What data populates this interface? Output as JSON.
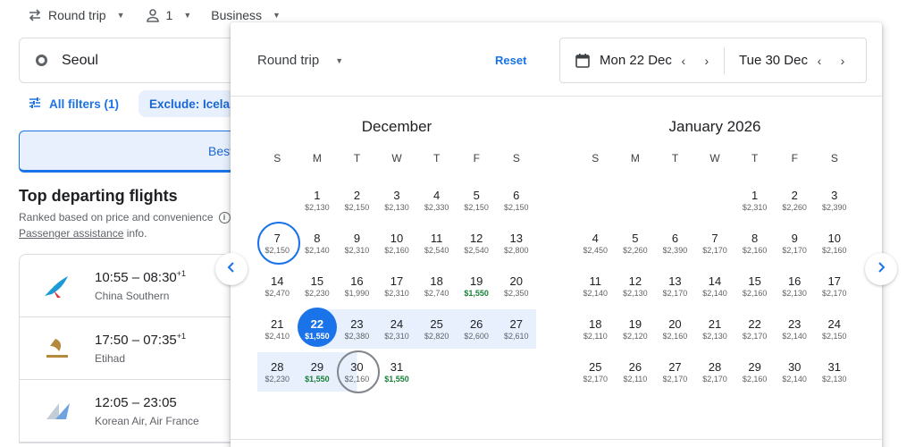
{
  "topbar": {
    "trip_type": "Round trip",
    "passengers": "1",
    "cabin": "Business"
  },
  "origin": {
    "value": "Seoul"
  },
  "filters": {
    "all_filters": "All filters (1)",
    "exclude_chip": "Exclude: Iceland"
  },
  "tabs": {
    "best": "Best"
  },
  "section": {
    "title": "Top departing flights",
    "subtitle": "Ranked based on price and convenience",
    "assistance_link": "Passenger assistance",
    "assistance_suffix": " info."
  },
  "flights": [
    {
      "times": "10:55 – 08:30",
      "plus": "+1",
      "airline": "China Southern"
    },
    {
      "times": "17:50 – 07:35",
      "plus": "+1",
      "airline": "Etihad"
    },
    {
      "times": "12:05 – 23:05",
      "plus": "",
      "airline": "Korean Air, Air France"
    }
  ],
  "popup": {
    "trip_type": "Round trip",
    "reset": "Reset",
    "departure": "Mon 22 Dec",
    "return": "Tue 30 Dec"
  },
  "calendar": {
    "weekdays": [
      "S",
      "M",
      "T",
      "W",
      "T",
      "F",
      "S"
    ],
    "months": [
      {
        "title": "December",
        "offset": 1,
        "days": [
          {
            "d": "1",
            "p": "$2,130"
          },
          {
            "d": "2",
            "p": "$2,150"
          },
          {
            "d": "3",
            "p": "$2,130"
          },
          {
            "d": "4",
            "p": "$2,330"
          },
          {
            "d": "5",
            "p": "$2,150"
          },
          {
            "d": "6",
            "p": "$2,150"
          },
          {
            "d": "7",
            "p": "$2,150"
          },
          {
            "d": "8",
            "p": "$2,140"
          },
          {
            "d": "9",
            "p": "$2,310"
          },
          {
            "d": "10",
            "p": "$2,160"
          },
          {
            "d": "11",
            "p": "$2,540"
          },
          {
            "d": "12",
            "p": "$2,540"
          },
          {
            "d": "13",
            "p": "$2,800"
          },
          {
            "d": "14",
            "p": "$2,470"
          },
          {
            "d": "15",
            "p": "$2,230"
          },
          {
            "d": "16",
            "p": "$1,990"
          },
          {
            "d": "17",
            "p": "$2,310"
          },
          {
            "d": "18",
            "p": "$2,740"
          },
          {
            "d": "19",
            "p": "$1,550",
            "low": true
          },
          {
            "d": "20",
            "p": "$2,350"
          },
          {
            "d": "21",
            "p": "$2,410"
          },
          {
            "d": "22",
            "p": "$1,550",
            "low": true
          },
          {
            "d": "23",
            "p": "$2,380"
          },
          {
            "d": "24",
            "p": "$2,310"
          },
          {
            "d": "25",
            "p": "$2,820"
          },
          {
            "d": "26",
            "p": "$2,600"
          },
          {
            "d": "27",
            "p": "$2,610"
          },
          {
            "d": "28",
            "p": "$2,230"
          },
          {
            "d": "29",
            "p": "$1,550",
            "low": true
          },
          {
            "d": "30",
            "p": "$2,160"
          },
          {
            "d": "31",
            "p": "$1,550",
            "low": true
          }
        ]
      },
      {
        "title": "January 2026",
        "offset": 4,
        "days": [
          {
            "d": "1",
            "p": "$2,310"
          },
          {
            "d": "2",
            "p": "$2,260"
          },
          {
            "d": "3",
            "p": "$2,390"
          },
          {
            "d": "4",
            "p": "$2,450"
          },
          {
            "d": "5",
            "p": "$2,260"
          },
          {
            "d": "6",
            "p": "$2,390"
          },
          {
            "d": "7",
            "p": "$2,170"
          },
          {
            "d": "8",
            "p": "$2,160"
          },
          {
            "d": "9",
            "p": "$2,170"
          },
          {
            "d": "10",
            "p": "$2,160"
          },
          {
            "d": "11",
            "p": "$2,140"
          },
          {
            "d": "12",
            "p": "$2,130"
          },
          {
            "d": "13",
            "p": "$2,170"
          },
          {
            "d": "14",
            "p": "$2,140"
          },
          {
            "d": "15",
            "p": "$2,160"
          },
          {
            "d": "16",
            "p": "$2,130"
          },
          {
            "d": "17",
            "p": "$2,170"
          },
          {
            "d": "18",
            "p": "$2,110"
          },
          {
            "d": "19",
            "p": "$2,120"
          },
          {
            "d": "20",
            "p": "$2,160"
          },
          {
            "d": "21",
            "p": "$2,130"
          },
          {
            "d": "22",
            "p": "$2,170"
          },
          {
            "d": "23",
            "p": "$2,140"
          },
          {
            "d": "24",
            "p": "$2,150"
          },
          {
            "d": "25",
            "p": "$2,170"
          },
          {
            "d": "26",
            "p": "$2,110"
          },
          {
            "d": "27",
            "p": "$2,170"
          },
          {
            "d": "28",
            "p": "$2,170"
          },
          {
            "d": "29",
            "p": "$2,160"
          },
          {
            "d": "30",
            "p": "$2,140"
          },
          {
            "d": "31",
            "p": "$2,130"
          }
        ]
      }
    ],
    "today_ring": "7",
    "selected_departure": "22",
    "selected_return": "30"
  },
  "colors": {
    "accent": "#1a73e8",
    "range": "#e8f0fe",
    "low_price": "#188038"
  },
  "icons": {
    "swap": "swap-arrows-icon",
    "person": "person-icon",
    "calendar": "calendar-icon",
    "filter": "tune-icon",
    "info": "info-icon"
  }
}
